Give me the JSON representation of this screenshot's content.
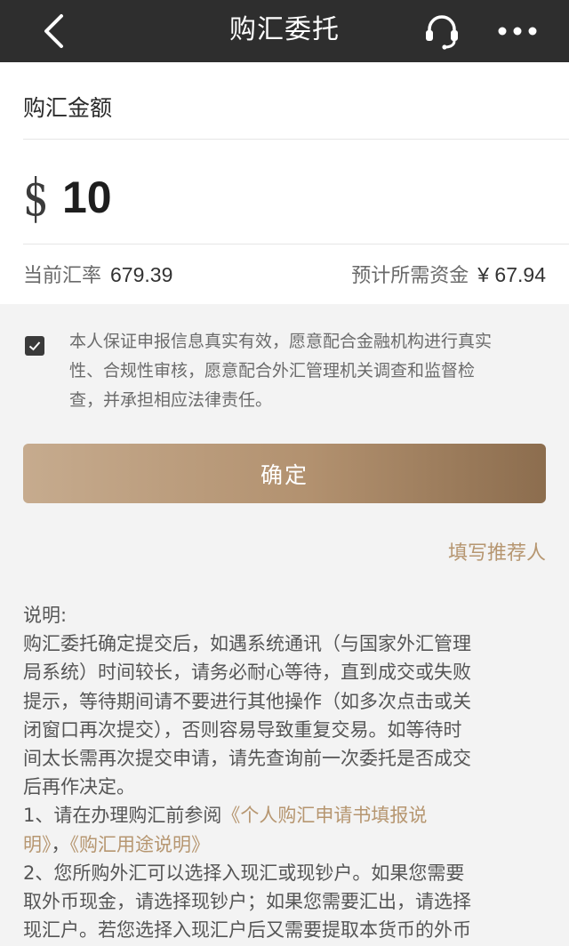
{
  "nav": {
    "title": "购汇委托",
    "icons": [
      "back-arrow-icon",
      "headset-icon",
      "more-dots-icon"
    ]
  },
  "amount_section": {
    "label": "购汇金额",
    "currency_symbol": "$",
    "amount_value": "10"
  },
  "rate": {
    "label": "当前汇率",
    "value": "679.39",
    "estimate_label": "预计所需资金",
    "estimate_value": "¥ 67.94"
  },
  "agreement": {
    "checked": true,
    "lines": [
      "本人保证申报信息真实有效，愿意配合金融机构进行真实",
      "性、合规性审核，愿意配合外汇管理机关调查和监督检",
      "查，并承担相应法律责任。"
    ]
  },
  "confirm_label": "确定",
  "referrer_label": "填写推荐人",
  "notes": {
    "lines": [
      "说明:",
      "购汇委托确定提交后，如遇系统通讯（与国家外汇管理",
      "局系统）时间较长，请务必耐心等待，直到成交或失败",
      "提示，等待期间请不要进行其他操作（如多次点击或关",
      "闭窗口再次提交），否则容易导致重复交易。如等待时",
      "间太长需再次提交申请，请先查询前一次委托是否成交",
      "后再作决定。"
    ],
    "item1_prefix": "1、请在办理购汇前参阅",
    "item1_link_a_part1": "《个人购汇申请书填报说",
    "item1_link_a_part2": "明》",
    "item1_sep": "，",
    "item1_link_b": "《购汇用途说明》",
    "item2_lines": [
      "2、您所购外汇可以选择入现汇或现钞户。如果您需要",
      "取外币现金，请选择现钞户；如果您需要汇出，请选择",
      "现汇户。若您选择入现汇户后又需要提取本货币的外币"
    ]
  },
  "colors": {
    "nav_bg": "#2e2e2e",
    "accent": "#b69670",
    "button_start": "#c6ab8e",
    "button_end": "#8c6d4e"
  }
}
